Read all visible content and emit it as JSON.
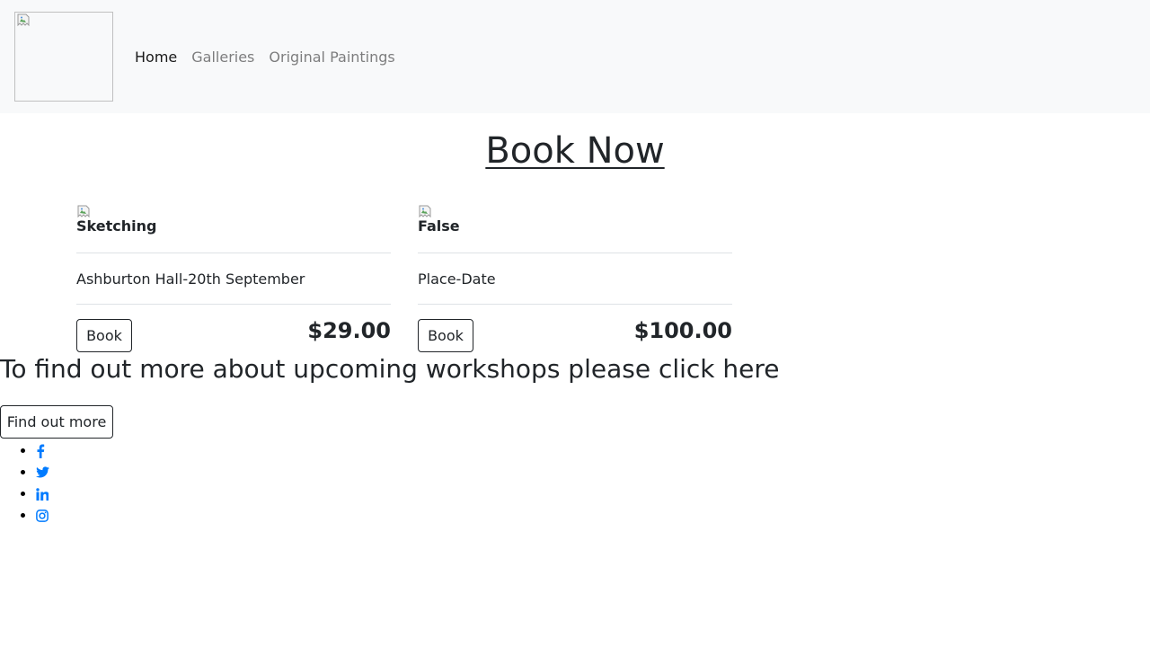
{
  "nav": {
    "items": [
      {
        "label": "Home"
      },
      {
        "label": "Galleries"
      },
      {
        "label": "Original Paintings"
      }
    ]
  },
  "main": {
    "title": "Book Now",
    "cards": [
      {
        "name": "Sketching",
        "place": "Ashburton Hall-20th September",
        "button": "Book",
        "price": "$29.00"
      },
      {
        "name": "False",
        "place": "Place-Date",
        "button": "Book",
        "price": "$100.00"
      }
    ],
    "workshops_text": "To find out more about upcoming workshops please click here",
    "find_button": "Find out more"
  },
  "social": {
    "icons": [
      "facebook-icon",
      "twitter-icon",
      "linkedin-icon",
      "instagram-icon"
    ],
    "color": "#007bff"
  },
  "colors": {
    "navbar_bg": "#f8f9fa",
    "text": "#212529",
    "link": "#007bff"
  }
}
